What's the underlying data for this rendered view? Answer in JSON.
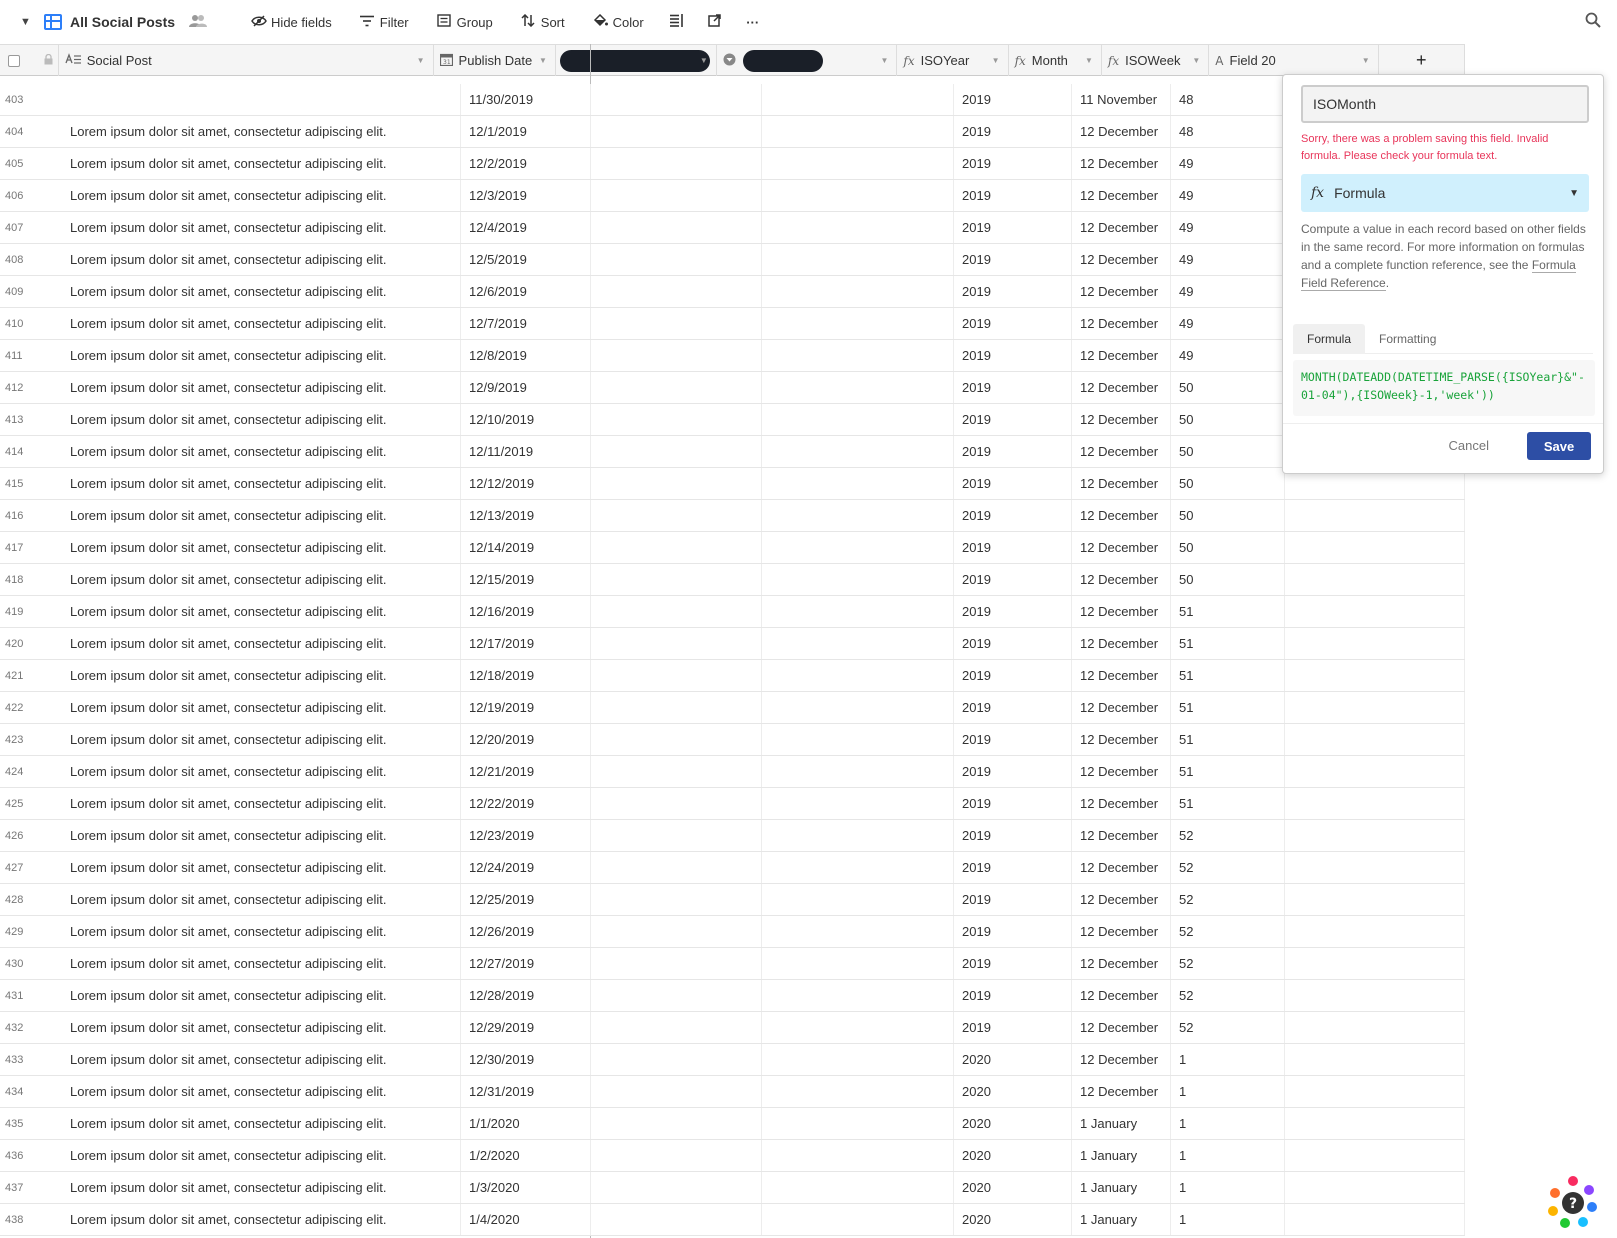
{
  "toolbar": {
    "view_name": "All Social Posts",
    "hide_fields": "Hide fields",
    "filter": "Filter",
    "group": "Group",
    "sort": "Sort",
    "color": "Color"
  },
  "columns": {
    "social_post": "Social Post",
    "publish_date": "Publish Date",
    "iso_year": "ISOYear",
    "month": "Month",
    "iso_week": "ISOWeek",
    "field20": "Field 20",
    "add": "+"
  },
  "rows": [
    {
      "n": "403",
      "post": "",
      "date": "11/30/2019",
      "year": "2019",
      "month": "11 November",
      "week": "48"
    },
    {
      "n": "404",
      "post": "Lorem ipsum dolor sit amet, consectetur adipiscing elit.",
      "date": "12/1/2019",
      "year": "2019",
      "month": "12 December",
      "week": "48"
    },
    {
      "n": "405",
      "post": "Lorem ipsum dolor sit amet, consectetur adipiscing elit.",
      "date": "12/2/2019",
      "year": "2019",
      "month": "12 December",
      "week": "49"
    },
    {
      "n": "406",
      "post": "Lorem ipsum dolor sit amet, consectetur adipiscing elit.",
      "date": "12/3/2019",
      "year": "2019",
      "month": "12 December",
      "week": "49"
    },
    {
      "n": "407",
      "post": "Lorem ipsum dolor sit amet, consectetur adipiscing elit.",
      "date": "12/4/2019",
      "year": "2019",
      "month": "12 December",
      "week": "49"
    },
    {
      "n": "408",
      "post": "Lorem ipsum dolor sit amet, consectetur adipiscing elit.",
      "date": "12/5/2019",
      "year": "2019",
      "month": "12 December",
      "week": "49"
    },
    {
      "n": "409",
      "post": "Lorem ipsum dolor sit amet, consectetur adipiscing elit.",
      "date": "12/6/2019",
      "year": "2019",
      "month": "12 December",
      "week": "49"
    },
    {
      "n": "410",
      "post": "Lorem ipsum dolor sit amet, consectetur adipiscing elit.",
      "date": "12/7/2019",
      "year": "2019",
      "month": "12 December",
      "week": "49"
    },
    {
      "n": "411",
      "post": "Lorem ipsum dolor sit amet, consectetur adipiscing elit.",
      "date": "12/8/2019",
      "year": "2019",
      "month": "12 December",
      "week": "49"
    },
    {
      "n": "412",
      "post": "Lorem ipsum dolor sit amet, consectetur adipiscing elit.",
      "date": "12/9/2019",
      "year": "2019",
      "month": "12 December",
      "week": "50"
    },
    {
      "n": "413",
      "post": "Lorem ipsum dolor sit amet, consectetur adipiscing elit.",
      "date": "12/10/2019",
      "year": "2019",
      "month": "12 December",
      "week": "50"
    },
    {
      "n": "414",
      "post": "Lorem ipsum dolor sit amet, consectetur adipiscing elit.",
      "date": "12/11/2019",
      "year": "2019",
      "month": "12 December",
      "week": "50"
    },
    {
      "n": "415",
      "post": "Lorem ipsum dolor sit amet, consectetur adipiscing elit.",
      "date": "12/12/2019",
      "year": "2019",
      "month": "12 December",
      "week": "50"
    },
    {
      "n": "416",
      "post": "Lorem ipsum dolor sit amet, consectetur adipiscing elit.",
      "date": "12/13/2019",
      "year": "2019",
      "month": "12 December",
      "week": "50"
    },
    {
      "n": "417",
      "post": "Lorem ipsum dolor sit amet, consectetur adipiscing elit.",
      "date": "12/14/2019",
      "year": "2019",
      "month": "12 December",
      "week": "50"
    },
    {
      "n": "418",
      "post": "Lorem ipsum dolor sit amet, consectetur adipiscing elit.",
      "date": "12/15/2019",
      "year": "2019",
      "month": "12 December",
      "week": "50"
    },
    {
      "n": "419",
      "post": "Lorem ipsum dolor sit amet, consectetur adipiscing elit.",
      "date": "12/16/2019",
      "year": "2019",
      "month": "12 December",
      "week": "51"
    },
    {
      "n": "420",
      "post": "Lorem ipsum dolor sit amet, consectetur adipiscing elit.",
      "date": "12/17/2019",
      "year": "2019",
      "month": "12 December",
      "week": "51"
    },
    {
      "n": "421",
      "post": "Lorem ipsum dolor sit amet, consectetur adipiscing elit.",
      "date": "12/18/2019",
      "year": "2019",
      "month": "12 December",
      "week": "51"
    },
    {
      "n": "422",
      "post": "Lorem ipsum dolor sit amet, consectetur adipiscing elit.",
      "date": "12/19/2019",
      "year": "2019",
      "month": "12 December",
      "week": "51"
    },
    {
      "n": "423",
      "post": "Lorem ipsum dolor sit amet, consectetur adipiscing elit.",
      "date": "12/20/2019",
      "year": "2019",
      "month": "12 December",
      "week": "51"
    },
    {
      "n": "424",
      "post": "Lorem ipsum dolor sit amet, consectetur adipiscing elit.",
      "date": "12/21/2019",
      "year": "2019",
      "month": "12 December",
      "week": "51"
    },
    {
      "n": "425",
      "post": "Lorem ipsum dolor sit amet, consectetur adipiscing elit.",
      "date": "12/22/2019",
      "year": "2019",
      "month": "12 December",
      "week": "51"
    },
    {
      "n": "426",
      "post": "Lorem ipsum dolor sit amet, consectetur adipiscing elit.",
      "date": "12/23/2019",
      "year": "2019",
      "month": "12 December",
      "week": "52"
    },
    {
      "n": "427",
      "post": "Lorem ipsum dolor sit amet, consectetur adipiscing elit.",
      "date": "12/24/2019",
      "year": "2019",
      "month": "12 December",
      "week": "52"
    },
    {
      "n": "428",
      "post": "Lorem ipsum dolor sit amet, consectetur adipiscing elit.",
      "date": "12/25/2019",
      "year": "2019",
      "month": "12 December",
      "week": "52"
    },
    {
      "n": "429",
      "post": "Lorem ipsum dolor sit amet, consectetur adipiscing elit.",
      "date": "12/26/2019",
      "year": "2019",
      "month": "12 December",
      "week": "52"
    },
    {
      "n": "430",
      "post": "Lorem ipsum dolor sit amet, consectetur adipiscing elit.",
      "date": "12/27/2019",
      "year": "2019",
      "month": "12 December",
      "week": "52"
    },
    {
      "n": "431",
      "post": "Lorem ipsum dolor sit amet, consectetur adipiscing elit.",
      "date": "12/28/2019",
      "year": "2019",
      "month": "12 December",
      "week": "52"
    },
    {
      "n": "432",
      "post": "Lorem ipsum dolor sit amet, consectetur adipiscing elit.",
      "date": "12/29/2019",
      "year": "2019",
      "month": "12 December",
      "week": "52"
    },
    {
      "n": "433",
      "post": "Lorem ipsum dolor sit amet, consectetur adipiscing elit.",
      "date": "12/30/2019",
      "year": "2020",
      "month": "12 December",
      "week": "1"
    },
    {
      "n": "434",
      "post": "Lorem ipsum dolor sit amet, consectetur adipiscing elit.",
      "date": "12/31/2019",
      "year": "2020",
      "month": "12 December",
      "week": "1"
    },
    {
      "n": "435",
      "post": "Lorem ipsum dolor sit amet, consectetur adipiscing elit.",
      "date": "1/1/2020",
      "year": "2020",
      "month": "1 January",
      "week": "1"
    },
    {
      "n": "436",
      "post": "Lorem ipsum dolor sit amet, consectetur adipiscing elit.",
      "date": "1/2/2020",
      "year": "2020",
      "month": "1 January",
      "week": "1"
    },
    {
      "n": "437",
      "post": "Lorem ipsum dolor sit amet, consectetur adipiscing elit.",
      "date": "1/3/2020",
      "year": "2020",
      "month": "1 January",
      "week": "1"
    },
    {
      "n": "438",
      "post": "Lorem ipsum dolor sit amet, consectetur adipiscing elit.",
      "date": "1/4/2020",
      "year": "2020",
      "month": "1 January",
      "week": "1"
    }
  ],
  "popover": {
    "field_name_value": "ISOMonth",
    "error": "Sorry, there was a problem saving this field. Invalid formula. Please check your formula text.",
    "field_type": "Formula",
    "description_before": "Compute a value in each record based on other fields in the same record. For more information on formulas and a complete function reference, see the ",
    "description_link": "Formula Field Reference",
    "description_after": ".",
    "tab_formula": "Formula",
    "tab_formatting": "Formatting",
    "formula_text": "MONTH(DATEADD(DATETIME_PARSE({ISOYear}&\"-01-04\"),{ISOWeek}-1,'week'))",
    "cancel": "Cancel",
    "save": "Save"
  },
  "colors": {
    "accent_blue": "#2d7ff9",
    "save_blue": "#2d4ea5",
    "error_pink": "#e8355a",
    "formula_green": "#19a33a",
    "type_selector_bg": "#d0f0fd"
  }
}
